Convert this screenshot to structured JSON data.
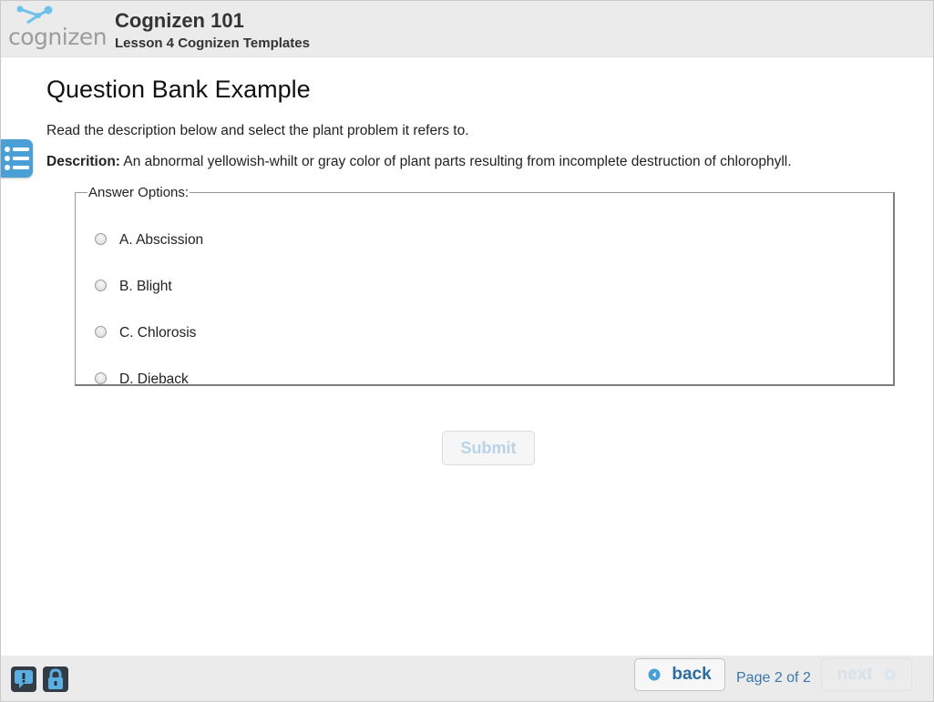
{
  "header": {
    "logo_text": "cognizen",
    "course_title": "Cognizen 101",
    "lesson_title": "Lesson 4 Cognizen Templates"
  },
  "content": {
    "heading": "Question Bank Example",
    "instructions": "Read the description below and select the plant problem it refers to.",
    "description_label": "Descrition:",
    "description_text": "An abnormal yellowish-whilt or gray color of plant parts resulting from incomplete destruction of chlorophyll.",
    "options_legend": "Answer Options:",
    "options": [
      {
        "label": "A. Abscission",
        "selected": false
      },
      {
        "label": "B. Blight",
        "selected": false
      },
      {
        "label": "C. Chlorosis",
        "selected": false
      },
      {
        "label": "D. Dieback",
        "selected": false
      }
    ],
    "submit_label": "Submit",
    "submit_enabled": false
  },
  "footer": {
    "help_icon": "help-comment-icon",
    "lock_icon": "lock-icon",
    "back_label": "back",
    "page_indicator": "Page 2 of 2",
    "next_label": "next",
    "next_enabled": false
  },
  "colors": {
    "header_bg": "#ebebeb",
    "accent_blue": "#4a9fd6",
    "nav_text": "#2c6c9c",
    "disabled_text": "#b9d3e7"
  }
}
